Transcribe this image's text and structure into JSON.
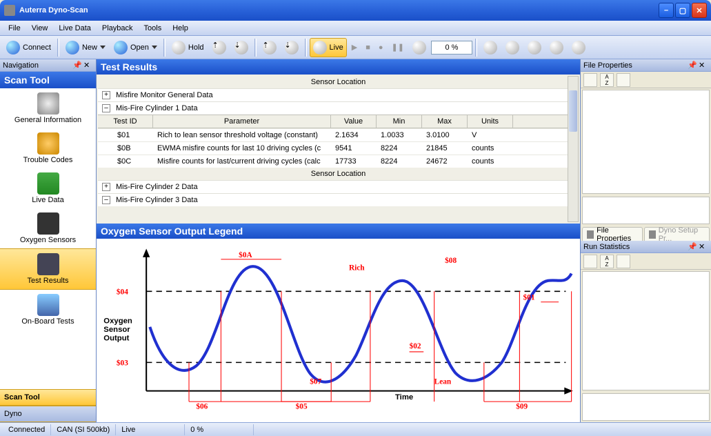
{
  "window": {
    "title": "Auterra Dyno-Scan"
  },
  "menu": [
    "File",
    "View",
    "Live Data",
    "Playback",
    "Tools",
    "Help"
  ],
  "toolbar": {
    "connect": "Connect",
    "new": "New",
    "open": "Open",
    "hold": "Hold",
    "live": "Live",
    "percent": "0 %"
  },
  "nav": {
    "header": "Navigation",
    "scanTool": "Scan Tool",
    "items": [
      {
        "label": "General Information"
      },
      {
        "label": "Trouble Codes"
      },
      {
        "label": "Live Data"
      },
      {
        "label": "Oxygen Sensors"
      },
      {
        "label": "Test Results"
      },
      {
        "label": "On-Board Tests"
      }
    ],
    "footer": [
      "Scan Tool",
      "Dyno"
    ]
  },
  "results": {
    "title": "Test Results",
    "sensorLoc": "Sensor Location",
    "rows": [
      {
        "type": "group",
        "expanded": false,
        "label": "Misfire Monitor General Data"
      },
      {
        "type": "group",
        "expanded": true,
        "label": "Mis-Fire Cylinder 1 Data"
      }
    ],
    "columns": [
      "Test ID",
      "Parameter",
      "Value",
      "Min",
      "Max",
      "Units"
    ],
    "data": [
      {
        "id": "$01",
        "param": "Rich to lean sensor threshold voltage (constant)",
        "val": "2.1634",
        "min": "1.0033",
        "max": "3.0100",
        "units": "V"
      },
      {
        "id": "$0B",
        "param": "EWMA misfire counts for last 10 driving cycles (c",
        "val": "9541",
        "min": "8224",
        "max": "21845",
        "units": "counts"
      },
      {
        "id": "$0C",
        "param": "Misfire counts for last/current driving cycles (calc",
        "val": "17733",
        "min": "8224",
        "max": "24672",
        "units": "counts"
      }
    ],
    "rows2": [
      {
        "type": "group",
        "expanded": false,
        "label": "Mis-Fire Cylinder 2 Data"
      },
      {
        "type": "group",
        "expanded": true,
        "label": "Mis-Fire Cylinder 3 Data"
      }
    ]
  },
  "chart": {
    "title": "Oxygen Sensor Output Legend",
    "ylabel": "Oxygen\nSensor\nOutput",
    "xlabel": "Time",
    "annotations": {
      "a04": "$04",
      "a03": "$03",
      "a0A": "$0A",
      "rich": "Rich",
      "lean": "Lean",
      "a08": "$08",
      "a02": "$02",
      "a01": "$01",
      "a06": "$06",
      "a07": "$07",
      "a05": "$05",
      "a09": "$09"
    }
  },
  "chart_data": {
    "type": "line",
    "title": "Oxygen Sensor Output Legend",
    "xlabel": "Time",
    "ylabel": "Oxygen Sensor Output",
    "x": [
      0,
      1,
      2,
      3,
      4,
      5,
      6,
      7,
      8,
      9,
      10,
      11,
      12,
      13,
      14,
      15,
      16,
      17,
      18,
      19,
      20,
      21,
      22,
      23,
      24
    ],
    "values": [
      50,
      25,
      20,
      30,
      60,
      85,
      95,
      85,
      60,
      30,
      15,
      20,
      40,
      70,
      88,
      82,
      60,
      35,
      22,
      28,
      50,
      78,
      90,
      85,
      95
    ],
    "ylim": [
      0,
      100
    ],
    "thresholds": {
      "$04_rich": 80,
      "$03_lean": 30
    },
    "time_markers": [
      "$06",
      "$07",
      "$05",
      "$09"
    ],
    "peak_markers": [
      "$0A",
      "$08",
      "$01",
      "$02"
    ]
  },
  "right": {
    "fileProps": "File Properties",
    "dynoSetup": "Dyno Setup Pr...",
    "runStats": "Run Statistics"
  },
  "status": {
    "conn": "Connected",
    "bus": "CAN (SI 500kb)",
    "mode": "Live",
    "pct": "0 %"
  }
}
